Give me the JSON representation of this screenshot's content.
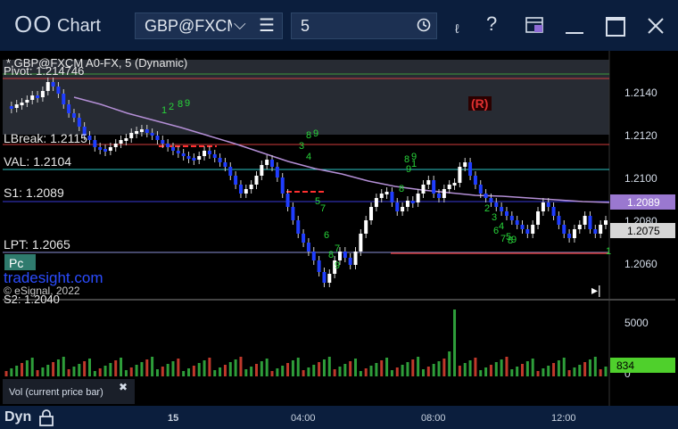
{
  "app": {
    "icon": "OO",
    "title": "Chart"
  },
  "toolbar": {
    "symbol": "GBP@FXCM",
    "interval": "5",
    "icons": [
      "dropdown-chevron-icon",
      "menu-icon",
      "clock-icon",
      "draw-icon",
      "help-icon",
      "layout-icon",
      "minimize-icon",
      "maximize-icon",
      "close-icon"
    ]
  },
  "chart": {
    "header": "*,GBP@FXCM A0-FX, 5 (Dynamic)",
    "levels": {
      "pivot": "Pivot: 1.214746",
      "lbreak": "LBreak: 1.2115",
      "val": "VAL: 1.2104",
      "s1": "S1: 1.2089",
      "lpt": "LPT: 1.2065",
      "s2": "S2: 1.2040",
      "pc": "Pc"
    },
    "watermark": "tradesight.com",
    "copyright": "© eSignal, 2022",
    "marker_r": "(R)",
    "price_axis": [
      "1.2140",
      "1.2120",
      "1.2100",
      "1.2080",
      "1.2060"
    ],
    "price_tags": {
      "upper": "1.2089",
      "current": "1.2075"
    },
    "volume_axis": [
      "5000",
      "0"
    ],
    "volume_tag": "834",
    "volume_label": "Vol (current price bar)",
    "close_glyph": "✖",
    "td_labels": [
      "8",
      "9",
      "8",
      "9",
      "8",
      "9",
      "7",
      "8",
      "9",
      "1",
      "2",
      "3",
      "4",
      "5",
      "6",
      "7",
      "8",
      "9",
      "1",
      "2",
      "3",
      "4",
      "5",
      "6",
      "7",
      "8",
      "9",
      "1"
    ],
    "colors": {
      "up_candle": "#ffffff",
      "down_candle": "#1f3dff",
      "volume_up": "#2e9e3a",
      "volume_down": "#c0392b",
      "ma": "#b48fd6",
      "td_green": "#28d43a"
    }
  },
  "status": {
    "label": "Dyn",
    "lock_icon": "lock-icon",
    "time_axis": [
      "15",
      "04:00",
      "08:00",
      "12:00"
    ]
  }
}
